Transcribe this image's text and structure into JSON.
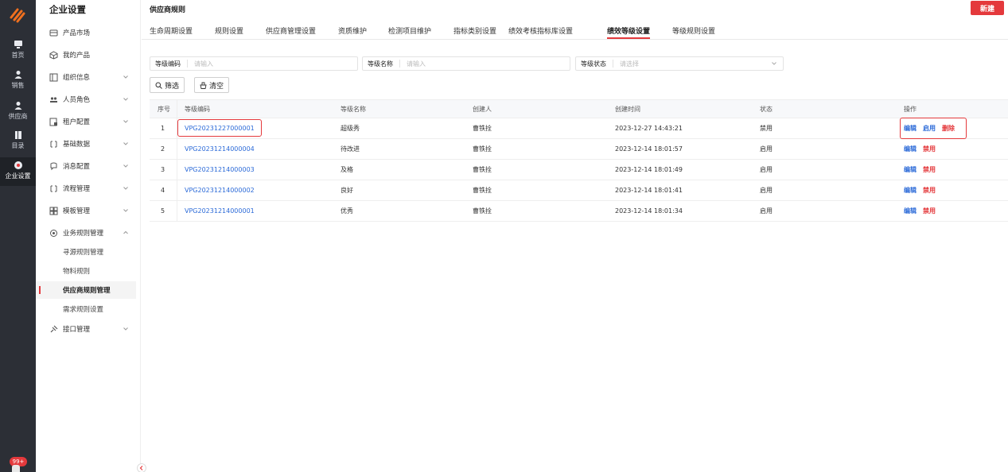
{
  "rail": {
    "items": [
      {
        "label": "首页",
        "icon": "monitor-icon"
      },
      {
        "label": "销售",
        "icon": "person-icon"
      },
      {
        "label": "供应商",
        "icon": "person-icon"
      },
      {
        "label": "目录",
        "icon": "book-icon"
      },
      {
        "label": "企业设置",
        "icon": "gear-icon"
      }
    ],
    "badge": "99+"
  },
  "sidebar": {
    "title": "企业设置",
    "items": [
      {
        "label": "产品市场",
        "icon": "market-icon",
        "expandable": false
      },
      {
        "label": "我的产品",
        "icon": "cube-icon",
        "expandable": false
      },
      {
        "label": "组织信息",
        "icon": "org-icon",
        "expandable": true
      },
      {
        "label": "人员角色",
        "icon": "people-icon",
        "expandable": true
      },
      {
        "label": "租户配置",
        "icon": "tenant-icon",
        "expandable": true
      },
      {
        "label": "基础数据",
        "icon": "data-icon",
        "expandable": true
      },
      {
        "label": "消息配置",
        "icon": "message-icon",
        "expandable": true
      },
      {
        "label": "流程管理",
        "icon": "flow-icon",
        "expandable": true
      },
      {
        "label": "模板管理",
        "icon": "template-icon",
        "expandable": true
      },
      {
        "label": "业务规则管理",
        "icon": "rule-gear-icon",
        "expandable": true
      }
    ],
    "sub_items": [
      {
        "label": "寻源规则管理"
      },
      {
        "label": "物料规则"
      },
      {
        "label": "供应商规则管理"
      },
      {
        "label": "需求规则设置"
      }
    ],
    "last_item": {
      "label": "接口管理",
      "icon": "plug-icon"
    }
  },
  "header": {
    "title": "供应商规则",
    "new_button": "新建"
  },
  "tabs": [
    {
      "label": "生命周期设置"
    },
    {
      "label": "规则设置"
    },
    {
      "label": "供应商管理设置"
    },
    {
      "label": "资质维护"
    },
    {
      "label": "检测项目维护"
    },
    {
      "label": "指标类别设置"
    },
    {
      "label": "绩效考核指标库设置"
    },
    {
      "label": "绩效等级设置"
    },
    {
      "label": "等级规则设置"
    }
  ],
  "active_tab": "绩效等级设置",
  "filters": {
    "code": {
      "label": "等级编码",
      "placeholder": "请输入"
    },
    "name": {
      "label": "等级名称",
      "placeholder": "请输入"
    },
    "status": {
      "label": "等级状态",
      "placeholder": "请选择"
    }
  },
  "buttons": {
    "filter": "筛选",
    "clear": "清空"
  },
  "table": {
    "columns": [
      "序号",
      "等级编码",
      "等级名称",
      "创建人",
      "创建时间",
      "状态",
      "操作"
    ],
    "rows": [
      {
        "index": "1",
        "code": "VPG20231227000001",
        "name": "超级秀",
        "creator": "曹铁拴",
        "created": "2023-12-27 14:43:21",
        "status": "禁用",
        "ops": [
          "编辑",
          "启用",
          "删除"
        ]
      },
      {
        "index": "2",
        "code": "VPG20231214000004",
        "name": "待改进",
        "creator": "曹铁拴",
        "created": "2023-12-14 18:01:57",
        "status": "启用",
        "ops": [
          "编辑",
          "禁用"
        ]
      },
      {
        "index": "3",
        "code": "VPG20231214000003",
        "name": "及格",
        "creator": "曹铁拴",
        "created": "2023-12-14 18:01:49",
        "status": "启用",
        "ops": [
          "编辑",
          "禁用"
        ]
      },
      {
        "index": "4",
        "code": "VPG20231214000002",
        "name": "良好",
        "creator": "曹铁拴",
        "created": "2023-12-14 18:01:41",
        "status": "启用",
        "ops": [
          "编辑",
          "禁用"
        ]
      },
      {
        "index": "5",
        "code": "VPG20231214000001",
        "name": "优秀",
        "creator": "曹铁拴",
        "created": "2023-12-14 18:01:34",
        "status": "启用",
        "ops": [
          "编辑",
          "禁用"
        ]
      }
    ]
  },
  "colors": {
    "accent": "#e4393c",
    "link": "#2b6ad8",
    "rail_bg": "#2c2f36"
  }
}
